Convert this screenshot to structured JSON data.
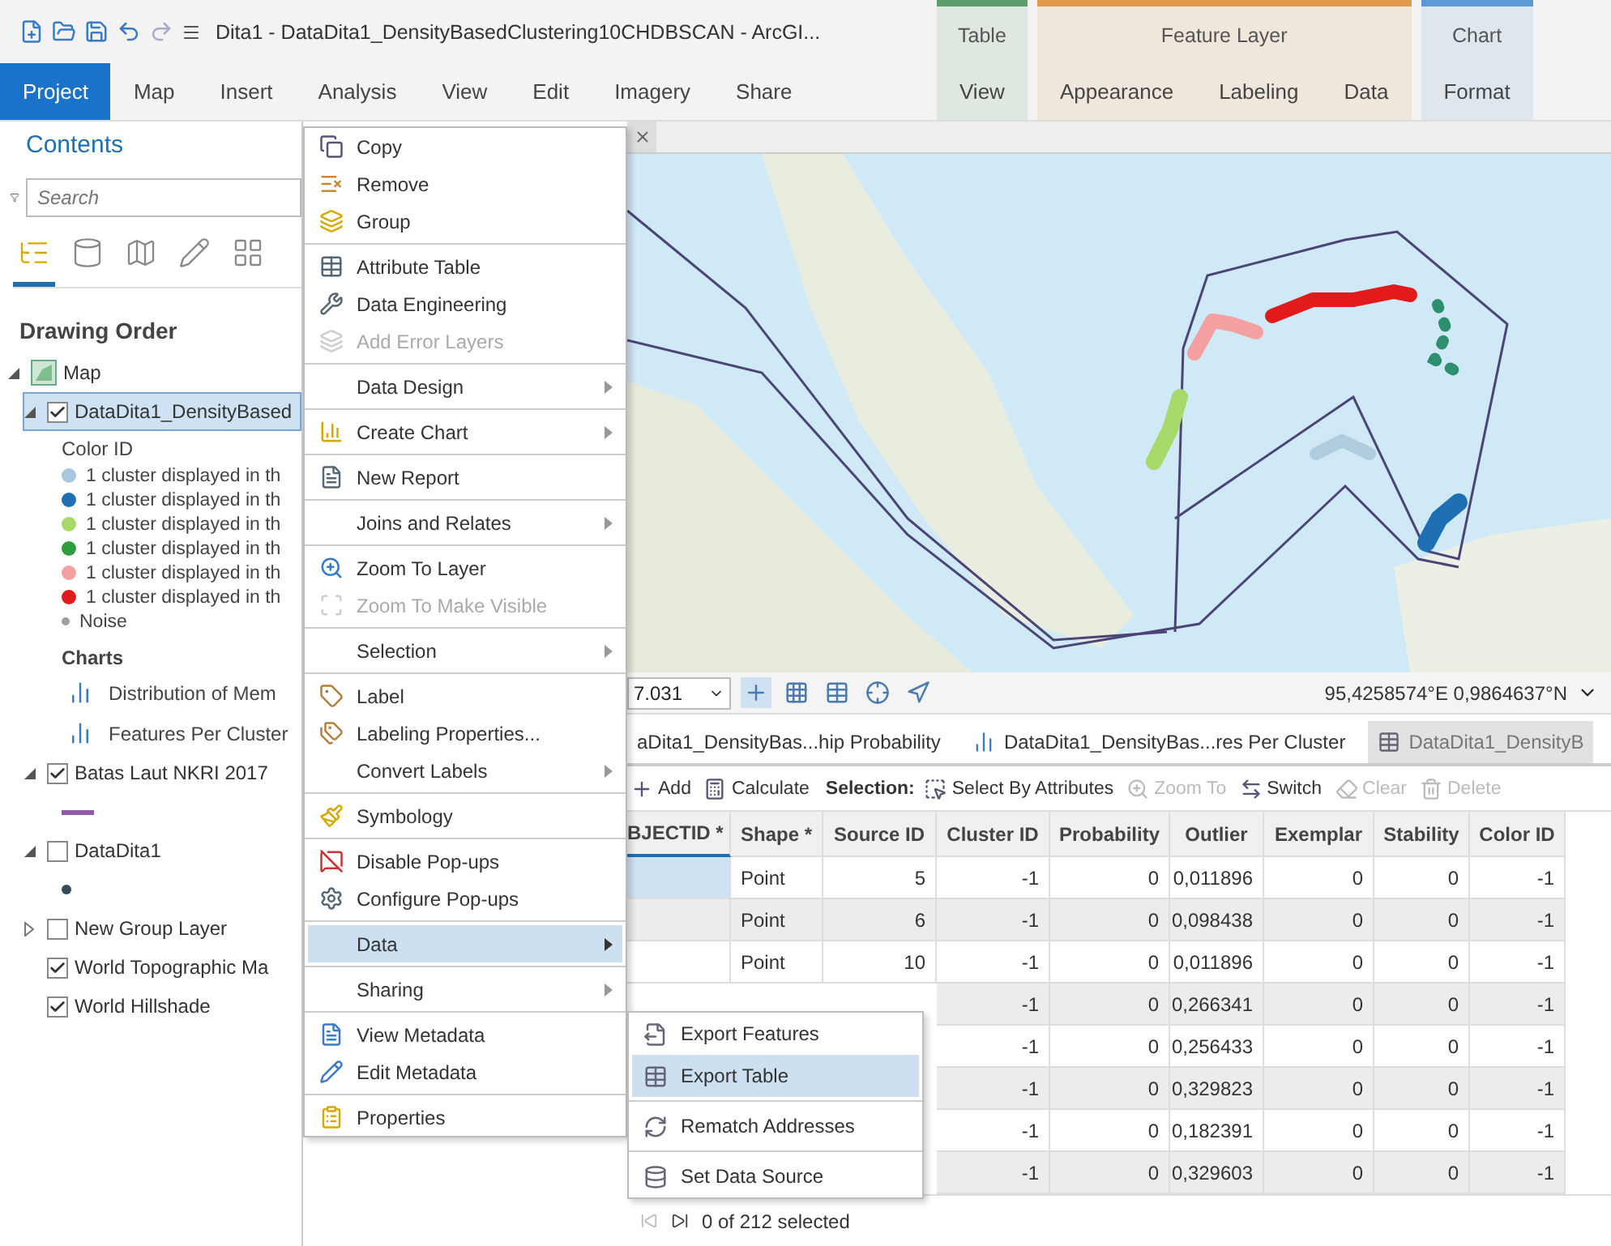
{
  "title_bar": {
    "title": "Dita1 - DataDita1_DensityBasedClustering10CHDBSCAN - ArcGI..."
  },
  "ribbon": {
    "tabs": [
      {
        "label": "Project",
        "selected": true
      },
      {
        "label": "Map",
        "selected": false
      },
      {
        "label": "Insert",
        "selected": false
      },
      {
        "label": "Analysis",
        "selected": false
      },
      {
        "label": "View",
        "selected": false
      },
      {
        "label": "Edit",
        "selected": false
      },
      {
        "label": "Imagery",
        "selected": false
      },
      {
        "label": "Share",
        "selected": false
      }
    ],
    "contextual": [
      {
        "title": "Table",
        "color": "#5c9e6c",
        "tabs": [
          {
            "label": "View",
            "selected": false
          }
        ]
      },
      {
        "title": "Feature Layer",
        "color": "#e39a4c",
        "tabs": [
          {
            "label": "Appearance",
            "selected": false
          },
          {
            "label": "Labeling",
            "selected": false
          },
          {
            "label": "Data",
            "selected": false
          }
        ]
      },
      {
        "title": "Chart",
        "color": "#5b9bd5",
        "tabs": [
          {
            "label": "Format",
            "selected": false
          }
        ]
      }
    ]
  },
  "contents": {
    "title": "Contents",
    "search": {
      "placeholder": "Search"
    },
    "view_tabs": [
      {
        "selected": true
      },
      {
        "selected": false
      },
      {
        "selected": false
      },
      {
        "selected": false
      },
      {
        "selected": false
      }
    ],
    "heading": "Drawing Order",
    "tree": [
      {
        "kind": "map",
        "name": "Map",
        "expanded": true,
        "children": [
          {
            "kind": "layer",
            "name": "DataDita1_DensityBased",
            "checked": true,
            "expanded": true,
            "selected": true,
            "legend_title": "Color ID",
            "classes": [
              {
                "label": "1 cluster displayed in th",
                "color": "#a6c8e0",
                "kind": "cluster"
              },
              {
                "label": "1 cluster displayed in th",
                "color": "#1f6fb5",
                "kind": "cluster"
              },
              {
                "label": "1 cluster displayed in th",
                "color": "#a6d96a",
                "kind": "cluster"
              },
              {
                "label": "1 cluster displayed in th",
                "color": "#2e9e3e",
                "kind": "cluster"
              },
              {
                "label": "1 cluster displayed in th",
                "color": "#f4a0a0",
                "kind": "cluster"
              },
              {
                "label": "1 cluster displayed in th",
                "color": "#e31a1c",
                "kind": "cluster"
              },
              {
                "label": "Noise",
                "color": "#9e9e9e",
                "kind": "noise"
              }
            ],
            "charts_title": "Charts",
            "charts": [
              {
                "label": "Distribution of Mem"
              },
              {
                "label": "Features Per Cluster"
              }
            ]
          },
          {
            "kind": "layer",
            "name": "Batas Laut NKRI 2017",
            "checked": true,
            "expanded": true,
            "selected": false,
            "classes": [
              {
                "kind": "line",
                "color": "#8e5ca8"
              }
            ]
          },
          {
            "kind": "layer",
            "name": "DataDita1",
            "checked": false,
            "expanded": true,
            "selected": false,
            "classes": [
              {
                "kind": "point",
                "color": "#2f4f5f"
              }
            ]
          },
          {
            "kind": "group",
            "name": "New Group Layer",
            "checked": false,
            "expanded": false,
            "selected": false
          },
          {
            "kind": "basemap",
            "name": "World Topographic Ma",
            "checked": true,
            "selected": false
          },
          {
            "kind": "basemap",
            "name": "World Hillshade",
            "checked": true,
            "selected": false
          }
        ]
      }
    ]
  },
  "map_status": {
    "scale": "7.031",
    "coordinates": "95,4258574°E 0,9864637°N",
    "tools": [
      {
        "selected": true
      },
      {
        "selected": false
      },
      {
        "selected": false
      },
      {
        "selected": false
      },
      {
        "selected": false
      }
    ]
  },
  "table_tabs": [
    {
      "label": "aDita1_DensityBas...hip Probability",
      "selected": false
    },
    {
      "label": "DataDita1_DensityBas...res Per Cluster",
      "kind": "chart",
      "selected": false
    },
    {
      "label": "DataDita1_DensityB",
      "kind": "table",
      "selected": true
    }
  ],
  "table_toolbar": [
    {
      "label": "Add",
      "kind": "button",
      "disabled": false
    },
    {
      "label": "Calculate",
      "kind": "button",
      "disabled": false
    },
    {
      "label": "Selection:",
      "kind": "label"
    },
    {
      "label": "Select By Attributes",
      "kind": "button",
      "disabled": false
    },
    {
      "label": "Zoom To",
      "kind": "button",
      "disabled": true
    },
    {
      "label": "Switch",
      "kind": "button",
      "disabled": false
    },
    {
      "label": "Clear",
      "kind": "button",
      "disabled": true
    },
    {
      "label": "Delete",
      "kind": "button",
      "disabled": true
    }
  ],
  "table": {
    "columns": [
      "BJECTID *",
      "Shape *",
      "Source ID",
      "Cluster ID",
      "Probability",
      "Outlier",
      "Exemplar",
      "Stability",
      "Color ID"
    ],
    "rows": [
      {
        "selected": true,
        "shape": "Point",
        "source_id": "5",
        "cluster_id": "-1",
        "probability": "0",
        "outlier": "0,011896",
        "exemplar": "0",
        "stability": "0",
        "color_id": "-1"
      },
      {
        "selected": false,
        "shape": "Point",
        "source_id": "6",
        "cluster_id": "-1",
        "probability": "0",
        "outlier": "0,098438",
        "exemplar": "0",
        "stability": "0",
        "color_id": "-1"
      },
      {
        "selected": false,
        "shape": "Point",
        "source_id": "10",
        "cluster_id": "-1",
        "probability": "0",
        "outlier": "0,011896",
        "exemplar": "0",
        "stability": "0",
        "color_id": "-1"
      },
      {
        "cluster_id": "-1",
        "probability": "0",
        "outlier": "0,266341",
        "exemplar": "0",
        "stability": "0",
        "color_id": "-1"
      },
      {
        "cluster_id": "-1",
        "probability": "0",
        "outlier": "0,256433",
        "exemplar": "0",
        "stability": "0",
        "color_id": "-1"
      },
      {
        "cluster_id": "-1",
        "probability": "0",
        "outlier": "0,329823",
        "exemplar": "0",
        "stability": "0",
        "color_id": "-1"
      },
      {
        "cluster_id": "-1",
        "probability": "0",
        "outlier": "0,182391",
        "exemplar": "0",
        "stability": "0",
        "color_id": "-1"
      },
      {
        "cluster_id": "-1",
        "probability": "0",
        "outlier": "0,329603",
        "exemplar": "0",
        "stability": "0",
        "color_id": "-1"
      }
    ],
    "footer": "0 of 212 selected"
  },
  "context_menu": [
    [
      {
        "label": "Copy",
        "disabled": false,
        "submenu": false,
        "selected": false
      },
      {
        "label": "Remove",
        "disabled": false,
        "submenu": false,
        "selected": false
      },
      {
        "label": "Group",
        "disabled": false,
        "submenu": false,
        "selected": false
      }
    ],
    [
      {
        "label": "Attribute Table",
        "disabled": false,
        "submenu": false,
        "selected": false
      },
      {
        "label": "Data Engineering",
        "disabled": false,
        "submenu": false,
        "selected": false
      },
      {
        "label": "Add Error Layers",
        "disabled": true,
        "submenu": false,
        "selected": false
      }
    ],
    [
      {
        "label": "Data Design",
        "disabled": false,
        "submenu": true,
        "selected": false
      }
    ],
    [
      {
        "label": "Create Chart",
        "disabled": false,
        "submenu": true,
        "selected": false
      }
    ],
    [
      {
        "label": "New Report",
        "disabled": false,
        "submenu": false,
        "selected": false
      }
    ],
    [
      {
        "label": "Joins and Relates",
        "disabled": false,
        "submenu": true,
        "selected": false
      }
    ],
    [
      {
        "label": "Zoom To Layer",
        "disabled": false,
        "submenu": false,
        "selected": false
      },
      {
        "label": "Zoom To Make Visible",
        "disabled": true,
        "submenu": false,
        "selected": false
      }
    ],
    [
      {
        "label": "Selection",
        "disabled": false,
        "submenu": true,
        "selected": false
      }
    ],
    [
      {
        "label": "Label",
        "disabled": false,
        "submenu": false,
        "selected": false
      },
      {
        "label": "Labeling Properties...",
        "disabled": false,
        "submenu": false,
        "selected": false
      },
      {
        "label": "Convert Labels",
        "disabled": false,
        "submenu": true,
        "selected": false
      }
    ],
    [
      {
        "label": "Symbology",
        "disabled": false,
        "submenu": false,
        "selected": false
      }
    ],
    [
      {
        "label": "Disable Pop-ups",
        "disabled": false,
        "submenu": false,
        "selected": false
      },
      {
        "label": "Configure Pop-ups",
        "disabled": false,
        "submenu": false,
        "selected": false
      }
    ],
    [
      {
        "label": "Data",
        "disabled": false,
        "submenu": true,
        "selected": true
      }
    ],
    [
      {
        "label": "Sharing",
        "disabled": false,
        "submenu": true,
        "selected": false
      }
    ],
    [
      {
        "label": "View Metadata",
        "disabled": false,
        "submenu": false,
        "selected": false
      },
      {
        "label": "Edit Metadata",
        "disabled": false,
        "submenu": false,
        "selected": false
      }
    ],
    [
      {
        "label": "Properties",
        "disabled": false,
        "submenu": false,
        "selected": false
      }
    ]
  ],
  "submenu": [
    [
      {
        "label": "Export Features",
        "selected": false
      },
      {
        "label": "Export Table",
        "selected": true
      }
    ],
    [
      {
        "label": "Rematch Addresses",
        "selected": false
      }
    ],
    [
      {
        "label": "Set Data Source",
        "selected": false
      }
    ]
  ]
}
